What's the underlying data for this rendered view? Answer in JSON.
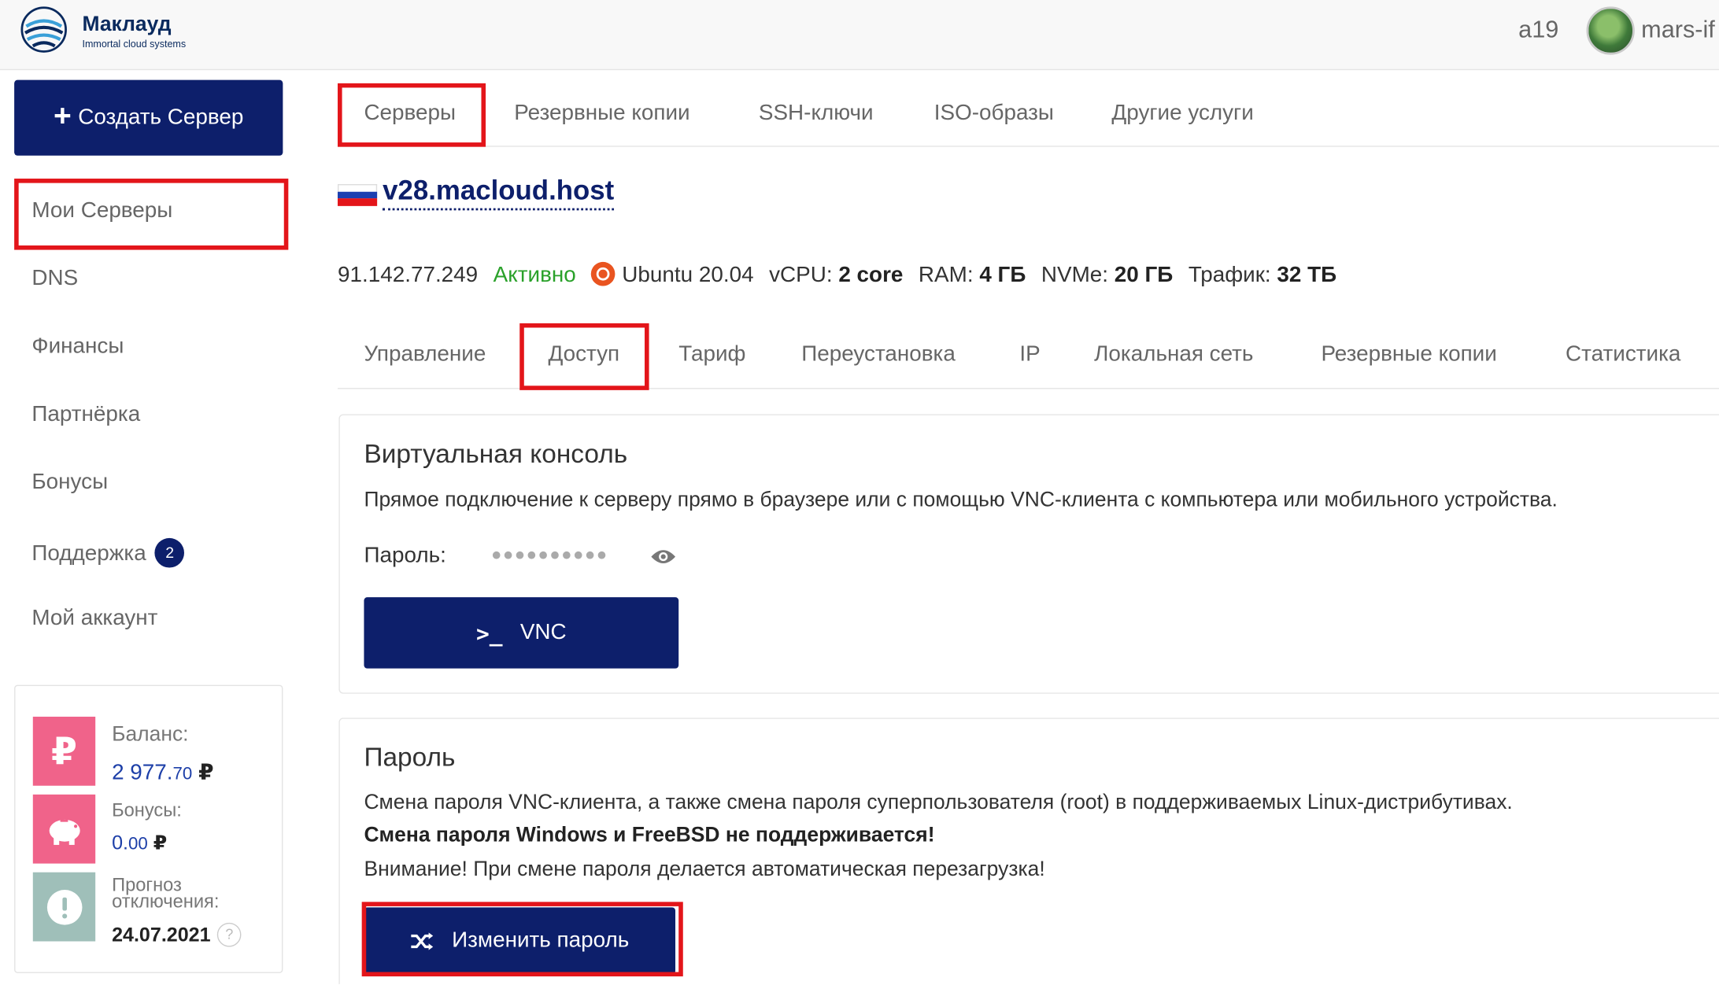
{
  "header": {
    "brand": "Маклауд",
    "brand_sub": "Immortal cloud systems",
    "user_num": "a19",
    "user_name": "mars-if"
  },
  "sidebar": {
    "create_button": "Создать Сервер",
    "items": [
      {
        "label": "Мои Серверы"
      },
      {
        "label": "DNS"
      },
      {
        "label": "Финансы"
      },
      {
        "label": "Партнёрка"
      },
      {
        "label": "Бонусы"
      },
      {
        "label": "Поддержка",
        "badge": "2"
      },
      {
        "label": "Мой аккаунт"
      }
    ],
    "balance": {
      "balance_label": "Баланс:",
      "balance_main": "2 977.",
      "balance_cents": "70",
      "currency": "₽",
      "bonus_label": "Бонусы:",
      "bonus_main": "0.",
      "bonus_cents": "00",
      "forecast_label_1": "Прогноз",
      "forecast_label_2": "отключения:",
      "forecast_date": "24.07.2021",
      "help": "?"
    }
  },
  "top_tabs": [
    "Серверы",
    "Резервные копии",
    "SSH-ключи",
    "ISO-образы",
    "Другие услуги"
  ],
  "server": {
    "name": "v28.macloud.host",
    "ip": "91.142.77.249",
    "status": "Активно",
    "os": "Ubuntu 20.04",
    "vcpu_label": "vCPU:",
    "vcpu_value": "2 core",
    "ram_label": "RAM:",
    "ram_value": "4 ГБ",
    "nvme_label": "NVMe:",
    "nvme_value": "20 ГБ",
    "traffic_label": "Трафик:",
    "traffic_value": "32 ТБ"
  },
  "sub_tabs": [
    "Управление",
    "Доступ",
    "Тариф",
    "Переустановка",
    "IP",
    "Локальная сеть",
    "Резервные копии",
    "Статистика"
  ],
  "console_panel": {
    "title": "Виртуальная консоль",
    "text": "Прямое подключение к серверу прямо в браузере или с помощью VNC-клиента с компьютера или мобильного устройства.",
    "password_label": "Пароль:",
    "password_mask": "●●●●●●●●●●",
    "vnc_button": "VNC",
    "vnc_icon": ">_"
  },
  "password_panel": {
    "title": "Пароль",
    "text1": "Смена пароля VNC-клиента, а также смена пароля суперпользователя (root) в поддерживаемых Linux-дистрибутивах.",
    "text2": "Смена пароля Windows и FreeBSD не поддерживается!",
    "text3": "Внимание! При смене пароля делается автоматическая перезагрузка!",
    "change_button": "Изменить пароль"
  },
  "colors": {
    "accent": "#0d1f6b",
    "highlight": "#e3151a",
    "active": "#2aa12a",
    "pink": "#f0638a",
    "teal": "#9fbfb9"
  }
}
